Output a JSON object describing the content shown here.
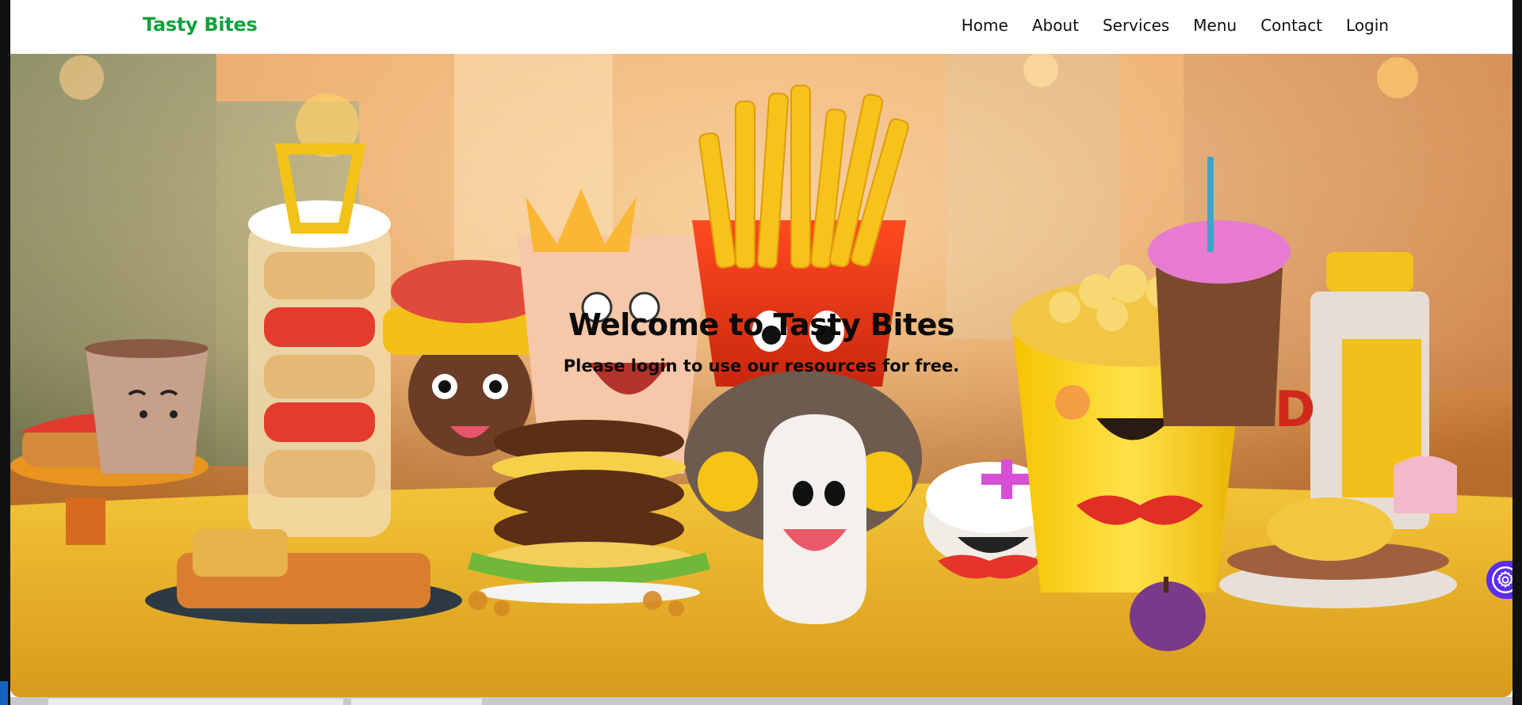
{
  "navbar": {
    "brand": "Tasty Bites",
    "links": [
      "Home",
      "About",
      "Services",
      "Menu",
      "Contact",
      "Login"
    ]
  },
  "hero": {
    "title": "Welcome to Tasty Bites",
    "subtitle": "Please login to use our resources for free.",
    "image": "cartoon-fast-food-characters-image"
  },
  "settings_button": {
    "icon": "gear-icon"
  },
  "colors": {
    "brand": "#14a03c",
    "settings_button": "#5a2df0"
  }
}
